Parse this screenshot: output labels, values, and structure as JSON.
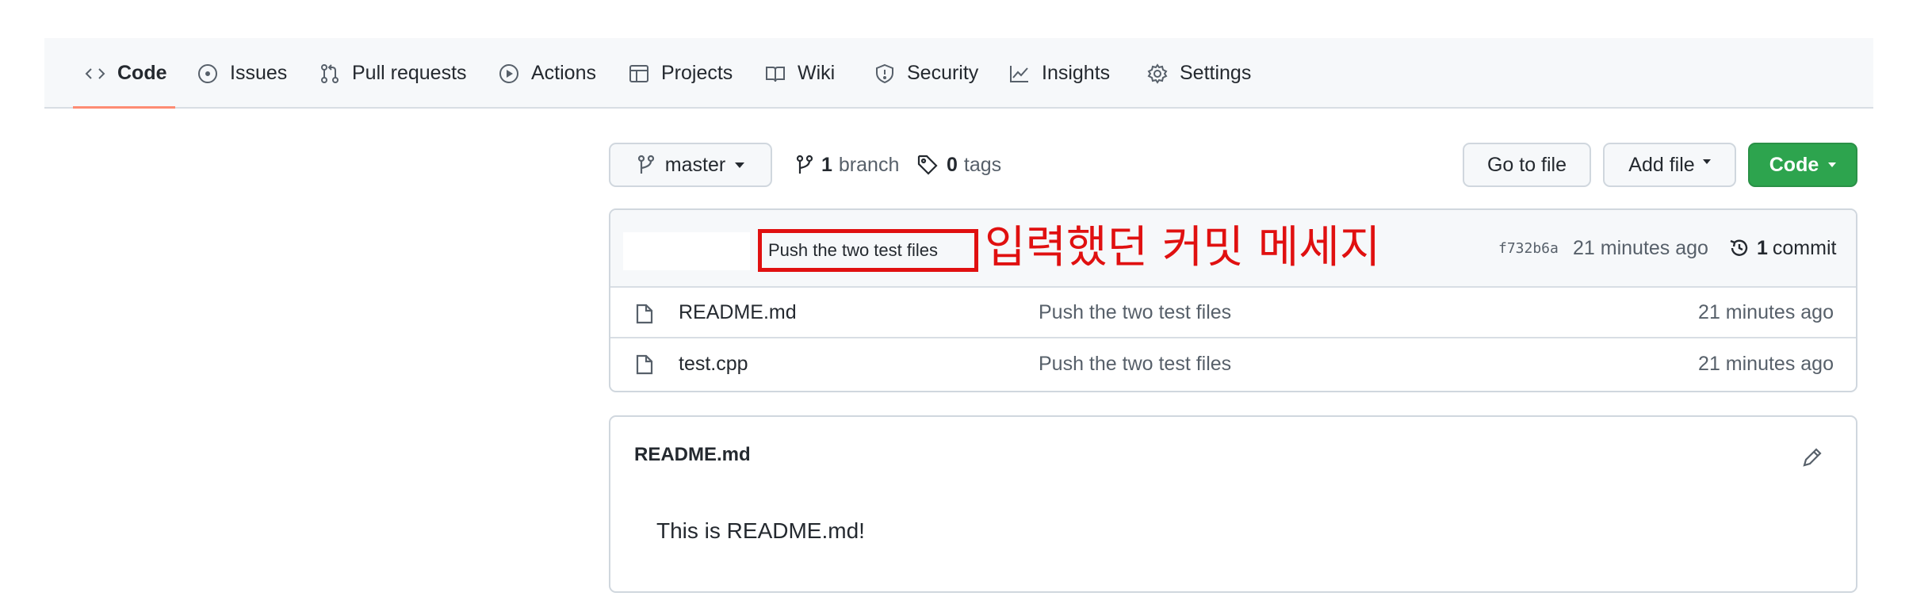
{
  "repo_nav": {
    "tabs": [
      {
        "label": "Code",
        "icon": "code-icon",
        "selected": true
      },
      {
        "label": "Issues",
        "icon": "issue-icon"
      },
      {
        "label": "Pull requests",
        "icon": "pull-request-icon"
      },
      {
        "label": "Actions",
        "icon": "play-icon"
      },
      {
        "label": "Projects",
        "icon": "table-icon"
      },
      {
        "label": "Wiki",
        "icon": "book-icon"
      },
      {
        "label": "Security",
        "icon": "shield-icon"
      },
      {
        "label": "Insights",
        "icon": "graph-icon"
      },
      {
        "label": "Settings",
        "icon": "gear-icon"
      }
    ]
  },
  "toolbar": {
    "branch_selector": "master",
    "branch_count": "1",
    "branch_label": "branch",
    "tag_count": "0",
    "tag_label": "tags",
    "go_to_file": "Go to file",
    "add_file": "Add file",
    "code_button": "Code"
  },
  "latest_commit": {
    "message": "Push the two test files",
    "annotation": "입력했던 커밋 메세지",
    "sha": "f732b6a",
    "age": "21 minutes ago",
    "commit_count": "1",
    "commit_label": "commit"
  },
  "files": [
    {
      "name": "README.md",
      "message": "Push the two test files",
      "age": "21 minutes ago"
    },
    {
      "name": "test.cpp",
      "message": "Push the two test files",
      "age": "21 minutes ago"
    }
  ],
  "readme": {
    "title": "README.md",
    "content": "This is README.md!"
  },
  "colors": {
    "accent_underline": "#fd8c73",
    "primary_button": "#2da44e",
    "annotation_red": "#e01010"
  }
}
